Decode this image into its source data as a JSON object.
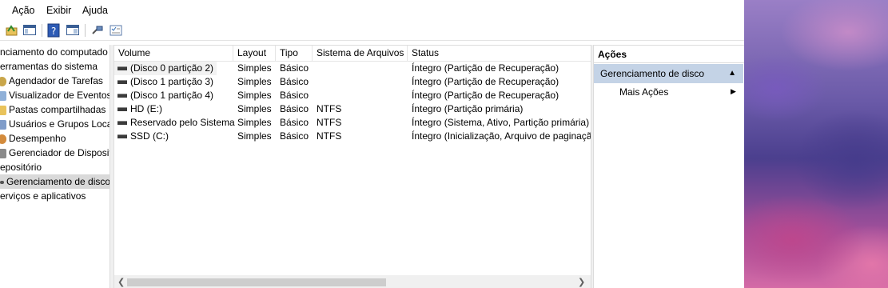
{
  "menu": [
    "Ação",
    "Exibir",
    "Ajuda"
  ],
  "tree": {
    "items": [
      {
        "label": "nciamento do computado",
        "icon": "computer-management-icon",
        "selected": false
      },
      {
        "label": "erramentas do sistema",
        "icon": "tools-icon",
        "selected": false
      },
      {
        "label": "Agendador de Tarefas",
        "icon": "task-scheduler-icon",
        "selected": false
      },
      {
        "label": "Visualizador de Eventos",
        "icon": "event-viewer-icon",
        "selected": false
      },
      {
        "label": "Pastas compartilhadas",
        "icon": "shared-folders-icon",
        "selected": false
      },
      {
        "label": "Usuários e Grupos Loca",
        "icon": "users-groups-icon",
        "selected": false
      },
      {
        "label": "Desempenho",
        "icon": "performance-icon",
        "selected": false
      },
      {
        "label": "Gerenciador de Disposit",
        "icon": "device-manager-icon",
        "selected": false
      },
      {
        "label": "epositório",
        "icon": "storage-icon",
        "selected": false
      },
      {
        "label": "Gerenciamento de disco",
        "icon": "disk-management-icon",
        "selected": true
      },
      {
        "label": "erviços e aplicativos",
        "icon": "services-icon",
        "selected": false
      }
    ]
  },
  "table": {
    "columns": [
      "Volume",
      "Layout",
      "Tipo",
      "Sistema de Arquivos",
      "Status"
    ],
    "rows": [
      [
        "(Disco 0 partição 2)",
        "Simples",
        "Básico",
        "",
        "Íntegro (Partição de Recuperação)"
      ],
      [
        "(Disco 1 partição 3)",
        "Simples",
        "Básico",
        "",
        "Íntegro (Partição de Recuperação)"
      ],
      [
        "(Disco 1 partição 4)",
        "Simples",
        "Básico",
        "",
        "Íntegro (Partição de Recuperação)"
      ],
      [
        "HD (E:)",
        "Simples",
        "Básico",
        "NTFS",
        "Íntegro (Partição primária)"
      ],
      [
        "Reservado pelo Sistema",
        "Simples",
        "Básico",
        "NTFS",
        "Íntegro (Sistema, Ativo, Partição primária)"
      ],
      [
        "SSD (C:)",
        "Simples",
        "Básico",
        "NTFS",
        "Íntegro (Inicialização, Arquivo de paginaçã"
      ]
    ]
  },
  "actions": {
    "title": "Ações",
    "section": "Gerenciamento de disco",
    "more": "Mais Ações"
  },
  "colors": {
    "accent_section": "#c4d3e6",
    "selected": "#d9d9d9"
  }
}
